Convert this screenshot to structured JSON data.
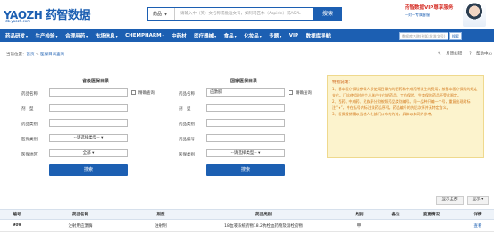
{
  "header": {
    "logo_text": "YAOZH",
    "logo_cn": "药智数据",
    "logo_sub": "db.yaozh.com",
    "search_category": "药品",
    "search_placeholder": "请输入中（英）文名称或批准文号，如阿司匹林（Aspirin）或ASPL",
    "search_button": "搜索",
    "promo_title": "药智数据VIP尊享服务",
    "promo_sub": "一对一专属客服"
  },
  "nav": {
    "items": [
      "药品研发",
      "生产检验",
      "合理用药",
      "市场信息",
      "CHEMPHARM",
      "中药材",
      "医疗器械",
      "食品",
      "化妆品",
      "专题",
      "VIP",
      "数据库导航"
    ],
    "has_caret": [
      true,
      true,
      true,
      true,
      true,
      false,
      true,
      true,
      true,
      true,
      false,
      false
    ],
    "search_placeholder": "数据库名称(例如:批准文号)",
    "search_button": "搜索"
  },
  "breadcrumb": {
    "prefix": "当前位置：",
    "home": "首页",
    "sep": " > ",
    "current": "医保目录查询"
  },
  "right_links": {
    "feedback": "反馈纠错",
    "help": "帮助中心"
  },
  "local_panel": {
    "title": "省级医保目录",
    "drug_name_label": "药品名称",
    "drug_name_value": "",
    "fuzzy_label": "精确查询",
    "dosage_label": "剂　型",
    "dosage_value": "",
    "category_label": "药品类别",
    "category_value": "",
    "insurance_type_label": "医保类别",
    "insurance_type_value": "--请选择类型--",
    "region_label": "医保地区",
    "region_value": "全部",
    "search_button": "搜索"
  },
  "national_panel": {
    "title": "国家医保目录",
    "drug_name_label": "药品名称",
    "drug_name_value": "应激胶",
    "fuzzy_label": "精确查询",
    "dosage_label": "剂　型",
    "dosage_value": "",
    "category_label": "药品类别",
    "category_value": "",
    "number_label": "药品编号",
    "number_value": "",
    "insurance_type_label": "医保类别",
    "insurance_type_value": "--请选择类型--",
    "search_button": "搜索"
  },
  "notice": {
    "title": "特别说明：",
    "items": [
      "1、基本医疗保险参保人员使用目录内的西药和中成药所发生的费用，按基本医疗保险的规定支付。门诊使用时由个人账户支付的药品，工伤保险、生育保险药品不受此限定。",
      "2、西药、中成药、民族药分别按照药品类别编号。同一品种只编一个号，重复出现时标注“★”，并在括号内标注该药品序号。药品编号的先后次序并无特定含义。",
      "3、医保报销需以当地人社部门公布的为准，具体以本网为参考。"
    ]
  },
  "table": {
    "show_all_button": "显示全部",
    "display_button": "显示",
    "headers": [
      "编号",
      "药品名称",
      "剂型",
      "药品类别",
      "类别",
      "备注",
      "变更情况",
      "详情"
    ],
    "rows": [
      {
        "id": "909",
        "name": "注射用应激酶",
        "dosage": "注射剂",
        "category": "18血液系统药物18.2抗栓血药物及溶栓药物",
        "type": "甲",
        "note": "",
        "change": "",
        "detail": "查看"
      }
    ]
  }
}
